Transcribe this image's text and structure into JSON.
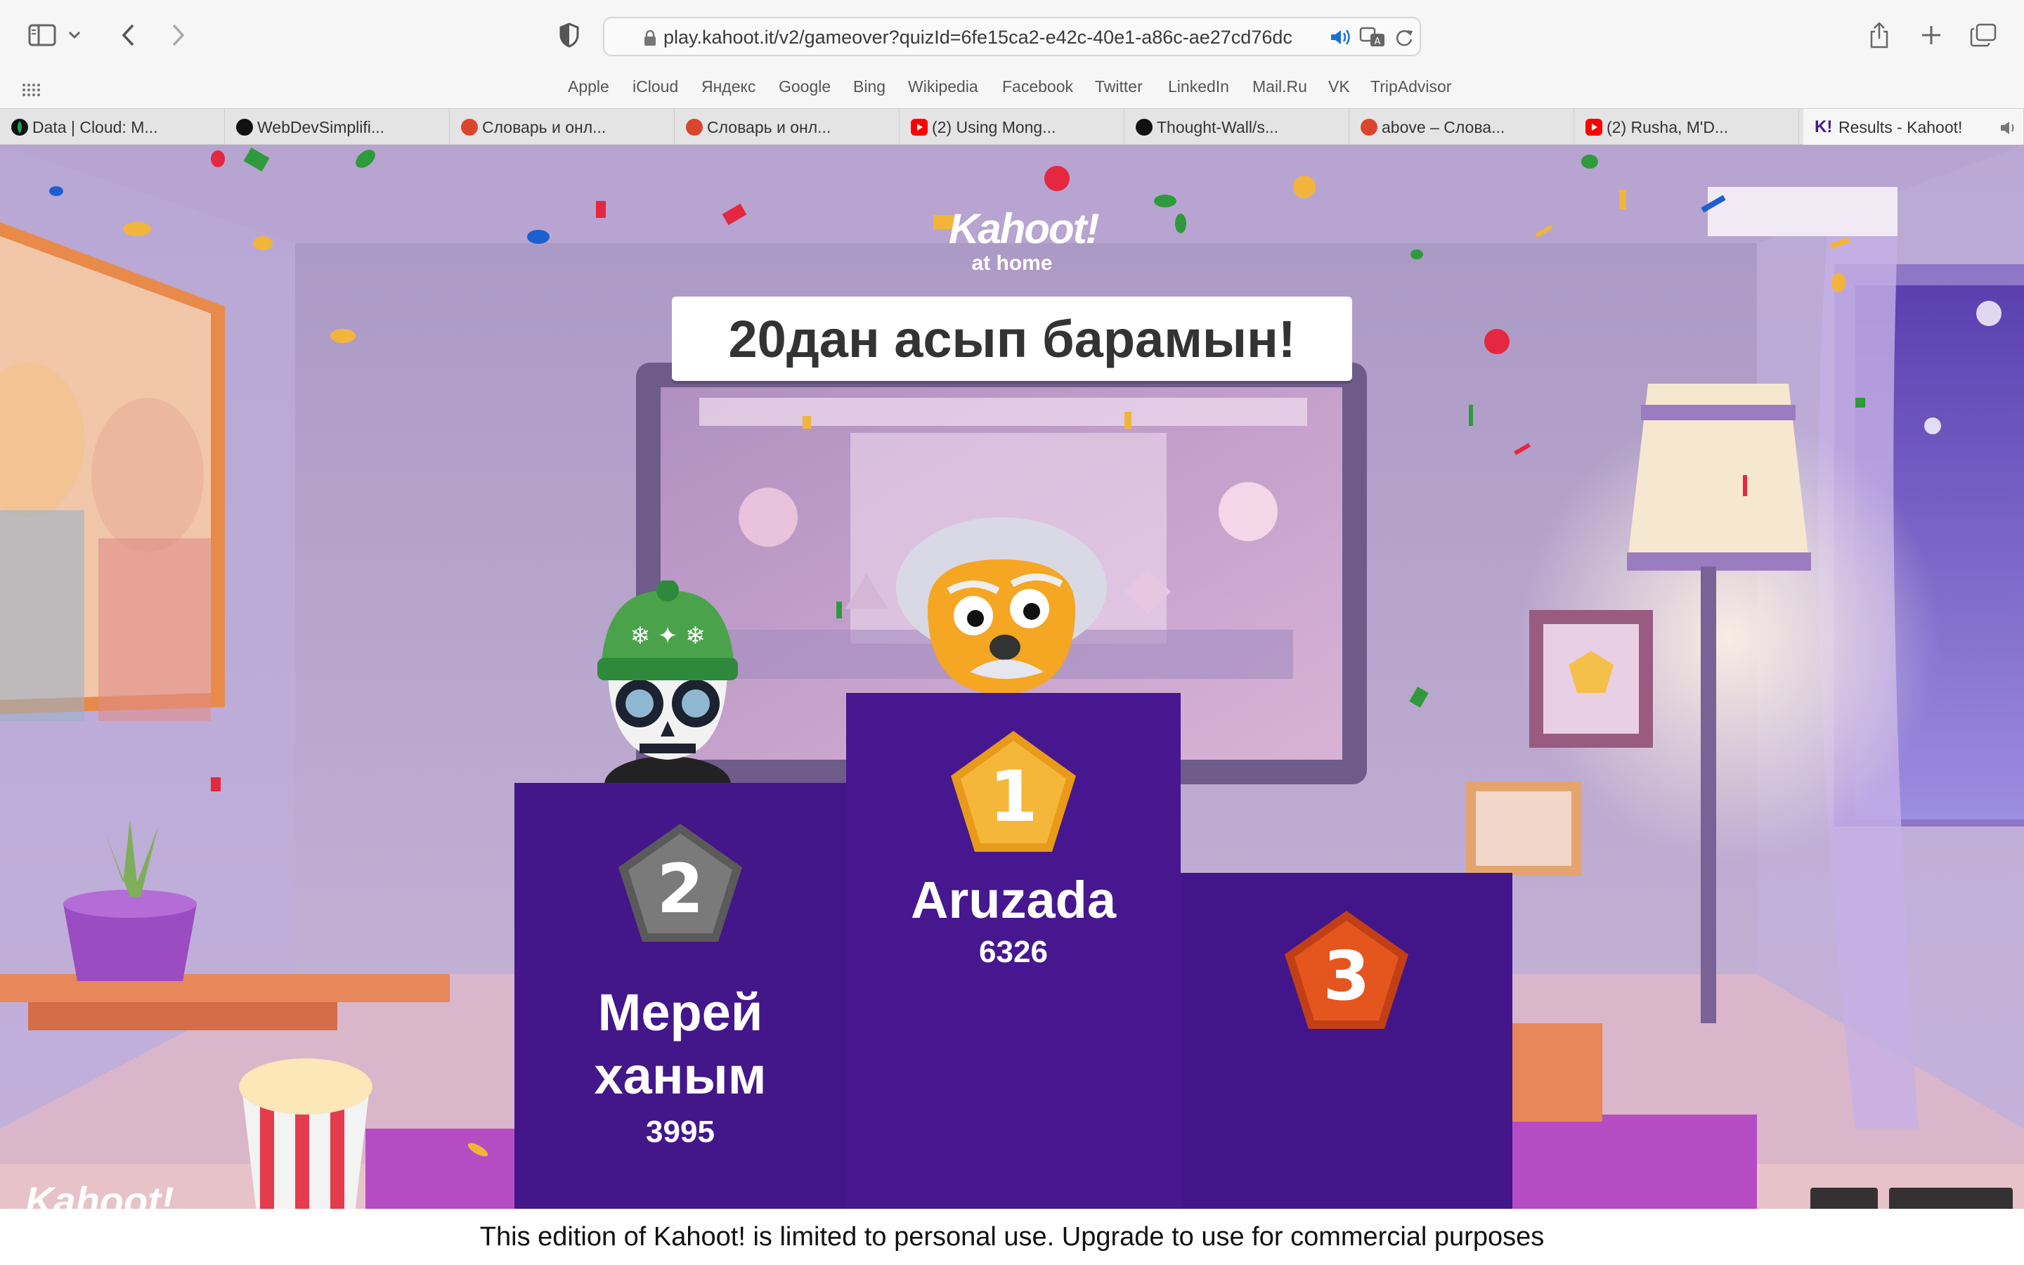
{
  "browser": {
    "url": "play.kahoot.it/v2/gameover?quizId=6fe15ca2-e42c-40e1-a86c-ae27cd76dc",
    "favorites": [
      "Apple",
      "iCloud",
      "Яндекс",
      "Google",
      "Bing",
      "Wikipedia",
      "Facebook",
      "Twitter",
      "LinkedIn",
      "Mail.Ru",
      "VK",
      "TripAdvisor"
    ],
    "tabs": [
      {
        "label": "Data | Cloud: M...",
        "icon": "mongodb-leaf-icon",
        "color": "#13aa52"
      },
      {
        "label": "WebDevSimplifi...",
        "icon": "github-icon",
        "color": "#111111"
      },
      {
        "label": "Словарь и онл...",
        "icon": "dictionary-icon",
        "color": "#d9462b"
      },
      {
        "label": "Словарь и онл...",
        "icon": "dictionary-icon",
        "color": "#d9462b"
      },
      {
        "label": "(2) Using Mong...",
        "icon": "youtube-icon",
        "color": "#ff0000"
      },
      {
        "label": "Thought-Wall/s...",
        "icon": "github-icon",
        "color": "#111111"
      },
      {
        "label": "above – Слова...",
        "icon": "dictionary-icon",
        "color": "#d9462b"
      },
      {
        "label": "(2) Rusha, M'D...",
        "icon": "youtube-icon",
        "color": "#ff0000"
      },
      {
        "label": "Results - Kahoot!",
        "icon": "kahoot-icon",
        "color": "#46178f"
      }
    ]
  },
  "game": {
    "logo": {
      "word": "Kahoot!",
      "sub": "at home"
    },
    "title": "20дан асып барамын!",
    "podium": [
      {
        "place": "1",
        "name": "Aruzada",
        "score": "6326"
      },
      {
        "place": "2",
        "name_line1": "Мерей",
        "name_line2": "ханым",
        "score": "3995"
      },
      {
        "place": "3"
      }
    ],
    "watermark": "Kahoot!",
    "footer": "This edition of Kahoot! is limited to personal use. Upgrade to use for commercial purposes"
  },
  "colors": {
    "podium": "#46178f",
    "gold": "#f5a623",
    "silver": "#6f6f6f",
    "bronze": "#e0521e"
  }
}
